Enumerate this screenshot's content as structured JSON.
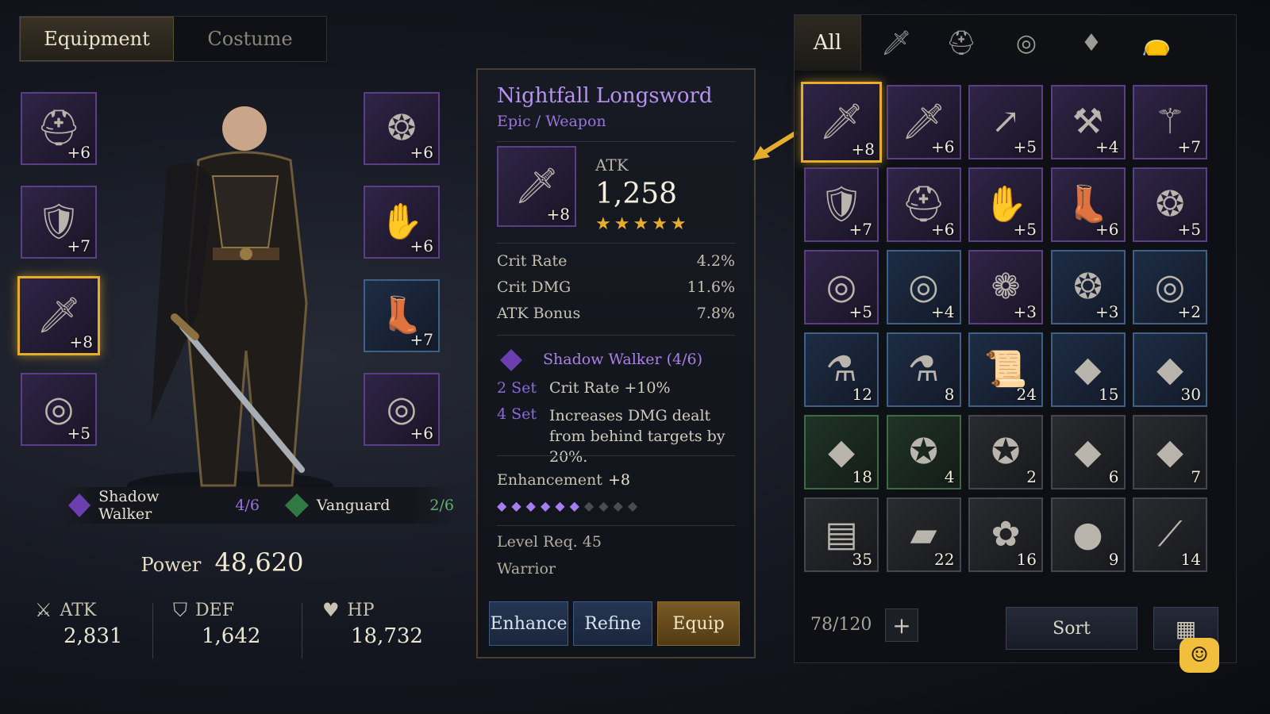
{
  "tabs": {
    "equipment": "Equipment",
    "costume": "Costume"
  },
  "equip_left": [
    {
      "icon": "helmet-icon",
      "glyph": "⛑",
      "level": "+6"
    },
    {
      "icon": "armor-icon",
      "glyph": "🛡",
      "level": "+7"
    },
    {
      "icon": "sword-icon",
      "glyph": "🗡",
      "level": "+8"
    },
    {
      "icon": "ring-icon",
      "glyph": "◎",
      "level": "+5"
    }
  ],
  "equip_right": [
    {
      "icon": "necklace-icon",
      "glyph": "❂",
      "level": "+6"
    },
    {
      "icon": "gauntlet-icon",
      "glyph": "✋",
      "level": "+6"
    },
    {
      "icon": "boots-icon",
      "glyph": "👢",
      "level": "+7"
    },
    {
      "icon": "ring-icon",
      "glyph": "◎",
      "level": "+6"
    }
  ],
  "sets": [
    {
      "name": "Shadow Walker",
      "count": "4/6",
      "color": "#8a5ad6"
    },
    {
      "name": "Vanguard",
      "count": "2/6",
      "color": "#4aa55e"
    }
  ],
  "power": {
    "label": "Power",
    "value": "48,620"
  },
  "stats": [
    {
      "label": "ATK",
      "value": "2,831",
      "icon": "sword-stat-icon"
    },
    {
      "label": "DEF",
      "value": "1,642",
      "icon": "shield-stat-icon"
    },
    {
      "label": "HP",
      "value": "18,732",
      "icon": "heart-stat-icon"
    }
  ],
  "detail": {
    "name": "Nightfall Longsword",
    "rarity": "Epic / Weapon",
    "level": "+8",
    "main_stat_label": "ATK",
    "main_stat_value": "1,258",
    "stars": "★★★★★",
    "substats": [
      {
        "label": "Crit Rate",
        "value": "4.2%"
      },
      {
        "label": "Crit DMG",
        "value": "11.6%"
      },
      {
        "label": "ATK Bonus",
        "value": "7.8%"
      }
    ],
    "set_name": "Shadow Walker (4/6)",
    "set_bonuses": [
      {
        "tier": "2 Set",
        "text": "Crit Rate +10%"
      },
      {
        "tier": "4 Set",
        "text": "Increases DMG dealt from behind targets by 20%."
      }
    ],
    "enhancement_label": "Enhancement",
    "enhancement_value": "+8",
    "enhancement_filled": 6,
    "enhancement_total": 10,
    "level_req": "Level Req. 45",
    "class": "Warrior",
    "buttons": {
      "enhance": "Enhance",
      "refine": "Refine",
      "equip": "Equip"
    }
  },
  "inventory": {
    "tabs": {
      "all": "All"
    },
    "capacity": "78/120",
    "sort": "Sort",
    "items": [
      {
        "icon": "sword-icon",
        "glyph": "🗡",
        "count": "+8",
        "rarity": "purple"
      },
      {
        "icon": "sword-icon",
        "glyph": "🗡",
        "count": "+6",
        "rarity": "purple"
      },
      {
        "icon": "spear-icon",
        "glyph": "↗",
        "count": "+5",
        "rarity": "purple"
      },
      {
        "icon": "axe-icon",
        "glyph": "⚒",
        "count": "+4",
        "rarity": "purple"
      },
      {
        "icon": "staff-icon",
        "glyph": "⚚",
        "count": "+7",
        "rarity": "purple"
      },
      {
        "icon": "armor-icon",
        "glyph": "🛡",
        "count": "+7",
        "rarity": "purple"
      },
      {
        "icon": "helmet-icon",
        "glyph": "⛑",
        "count": "+6",
        "rarity": "purple"
      },
      {
        "icon": "gauntlet-icon",
        "glyph": "✋",
        "count": "+5",
        "rarity": "purple"
      },
      {
        "icon": "boots-icon",
        "glyph": "👢",
        "count": "+6",
        "rarity": "purple"
      },
      {
        "icon": "necklace-icon",
        "glyph": "❂",
        "count": "+5",
        "rarity": "purple"
      },
      {
        "icon": "ring-icon",
        "glyph": "◎",
        "count": "+5",
        "rarity": "purple"
      },
      {
        "icon": "ring-icon",
        "glyph": "◎",
        "count": "+4",
        "rarity": "blue"
      },
      {
        "icon": "dragon-ring-icon",
        "glyph": "❁",
        "count": "+3",
        "rarity": "purple"
      },
      {
        "icon": "necklace-icon",
        "glyph": "❂",
        "count": "+3",
        "rarity": "blue"
      },
      {
        "icon": "ring-icon",
        "glyph": "◎",
        "count": "+2",
        "rarity": "blue"
      },
      {
        "icon": "red-potion-icon",
        "glyph": "⚗",
        "count": "12",
        "rarity": "blue"
      },
      {
        "icon": "blue-potion-icon",
        "glyph": "⚗",
        "count": "8",
        "rarity": "blue"
      },
      {
        "icon": "scroll-icon",
        "glyph": "📜",
        "count": "24",
        "rarity": "blue"
      },
      {
        "icon": "purple-crystal-icon",
        "glyph": "◆",
        "count": "15",
        "rarity": "blue"
      },
      {
        "icon": "green-crystal-icon",
        "glyph": "◆",
        "count": "30",
        "rarity": "blue"
      },
      {
        "icon": "emerald-icon",
        "glyph": "◆",
        "count": "18",
        "rarity": "green"
      },
      {
        "icon": "gold-coin-icon",
        "glyph": "✪",
        "count": "4",
        "rarity": "green"
      },
      {
        "icon": "silver-coin-icon",
        "glyph": "✪",
        "count": "2",
        "rarity": "gray"
      },
      {
        "icon": "gray-crystal-icon",
        "glyph": "◆",
        "count": "6",
        "rarity": "gray"
      },
      {
        "icon": "amber-crystal-icon",
        "glyph": "◆",
        "count": "7",
        "rarity": "gray"
      },
      {
        "icon": "wood-icon",
        "glyph": "▤",
        "count": "35",
        "rarity": "gray"
      },
      {
        "icon": "iron-ingot-icon",
        "glyph": "▰",
        "count": "22",
        "rarity": "gray"
      },
      {
        "icon": "leather-icon",
        "glyph": "✿",
        "count": "16",
        "rarity": "gray"
      },
      {
        "icon": "meat-icon",
        "glyph": "●",
        "count": "9",
        "rarity": "gray"
      },
      {
        "icon": "bone-icon",
        "glyph": "⟋",
        "count": "14",
        "rarity": "gray"
      }
    ]
  },
  "colors": {
    "gold": "#e6ad2c",
    "purple": "#9a72e0",
    "blue": "#3e5f86"
  }
}
